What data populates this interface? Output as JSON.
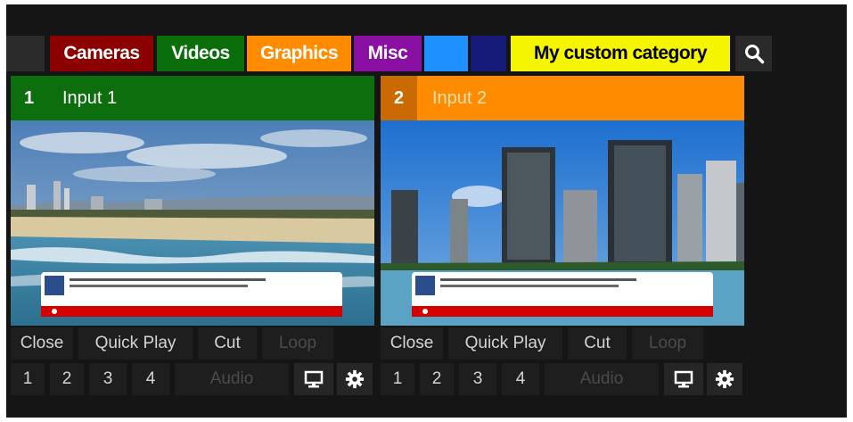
{
  "tabs": [
    {
      "label": "Cameras",
      "bg": "#8b0000",
      "fg": "#ffffff"
    },
    {
      "label": "Videos",
      "bg": "#0a6e0a",
      "fg": "#ffffff"
    },
    {
      "label": "Graphics",
      "bg": "#ff8c00",
      "fg": "#ffffff"
    },
    {
      "label": "Misc",
      "bg": "#8a0fa3",
      "fg": "#ffffff"
    },
    {
      "label": "",
      "bg": "#1e90ff",
      "fg": "#ffffff"
    },
    {
      "label": "",
      "bg": "#151a78",
      "fg": "#ffffff"
    },
    {
      "label": "My custom category",
      "bg": "#f5f500",
      "fg": "#000000"
    }
  ],
  "inputs": [
    {
      "number": "1",
      "title": "Input 1",
      "header_color": "#0d6e0d",
      "number_bg": "#0d6e0d",
      "title_color": "#ffffff",
      "actions": {
        "close": "Close",
        "quick_play": "Quick Play",
        "cut": "Cut",
        "loop": "Loop"
      },
      "overlays": [
        "1",
        "2",
        "3",
        "4"
      ],
      "audio": "Audio"
    },
    {
      "number": "2",
      "title": "Input 2",
      "header_color": "#ff8c00",
      "number_bg": "#ca6a00",
      "title_color": "#ffe0b0",
      "actions": {
        "close": "Close",
        "quick_play": "Quick Play",
        "cut": "Cut",
        "loop": "Loop"
      },
      "overlays": [
        "1",
        "2",
        "3",
        "4"
      ],
      "audio": "Audio"
    }
  ],
  "icons": {
    "search": "search-icon",
    "monitor": "monitor-icon",
    "settings": "gear-icon"
  }
}
